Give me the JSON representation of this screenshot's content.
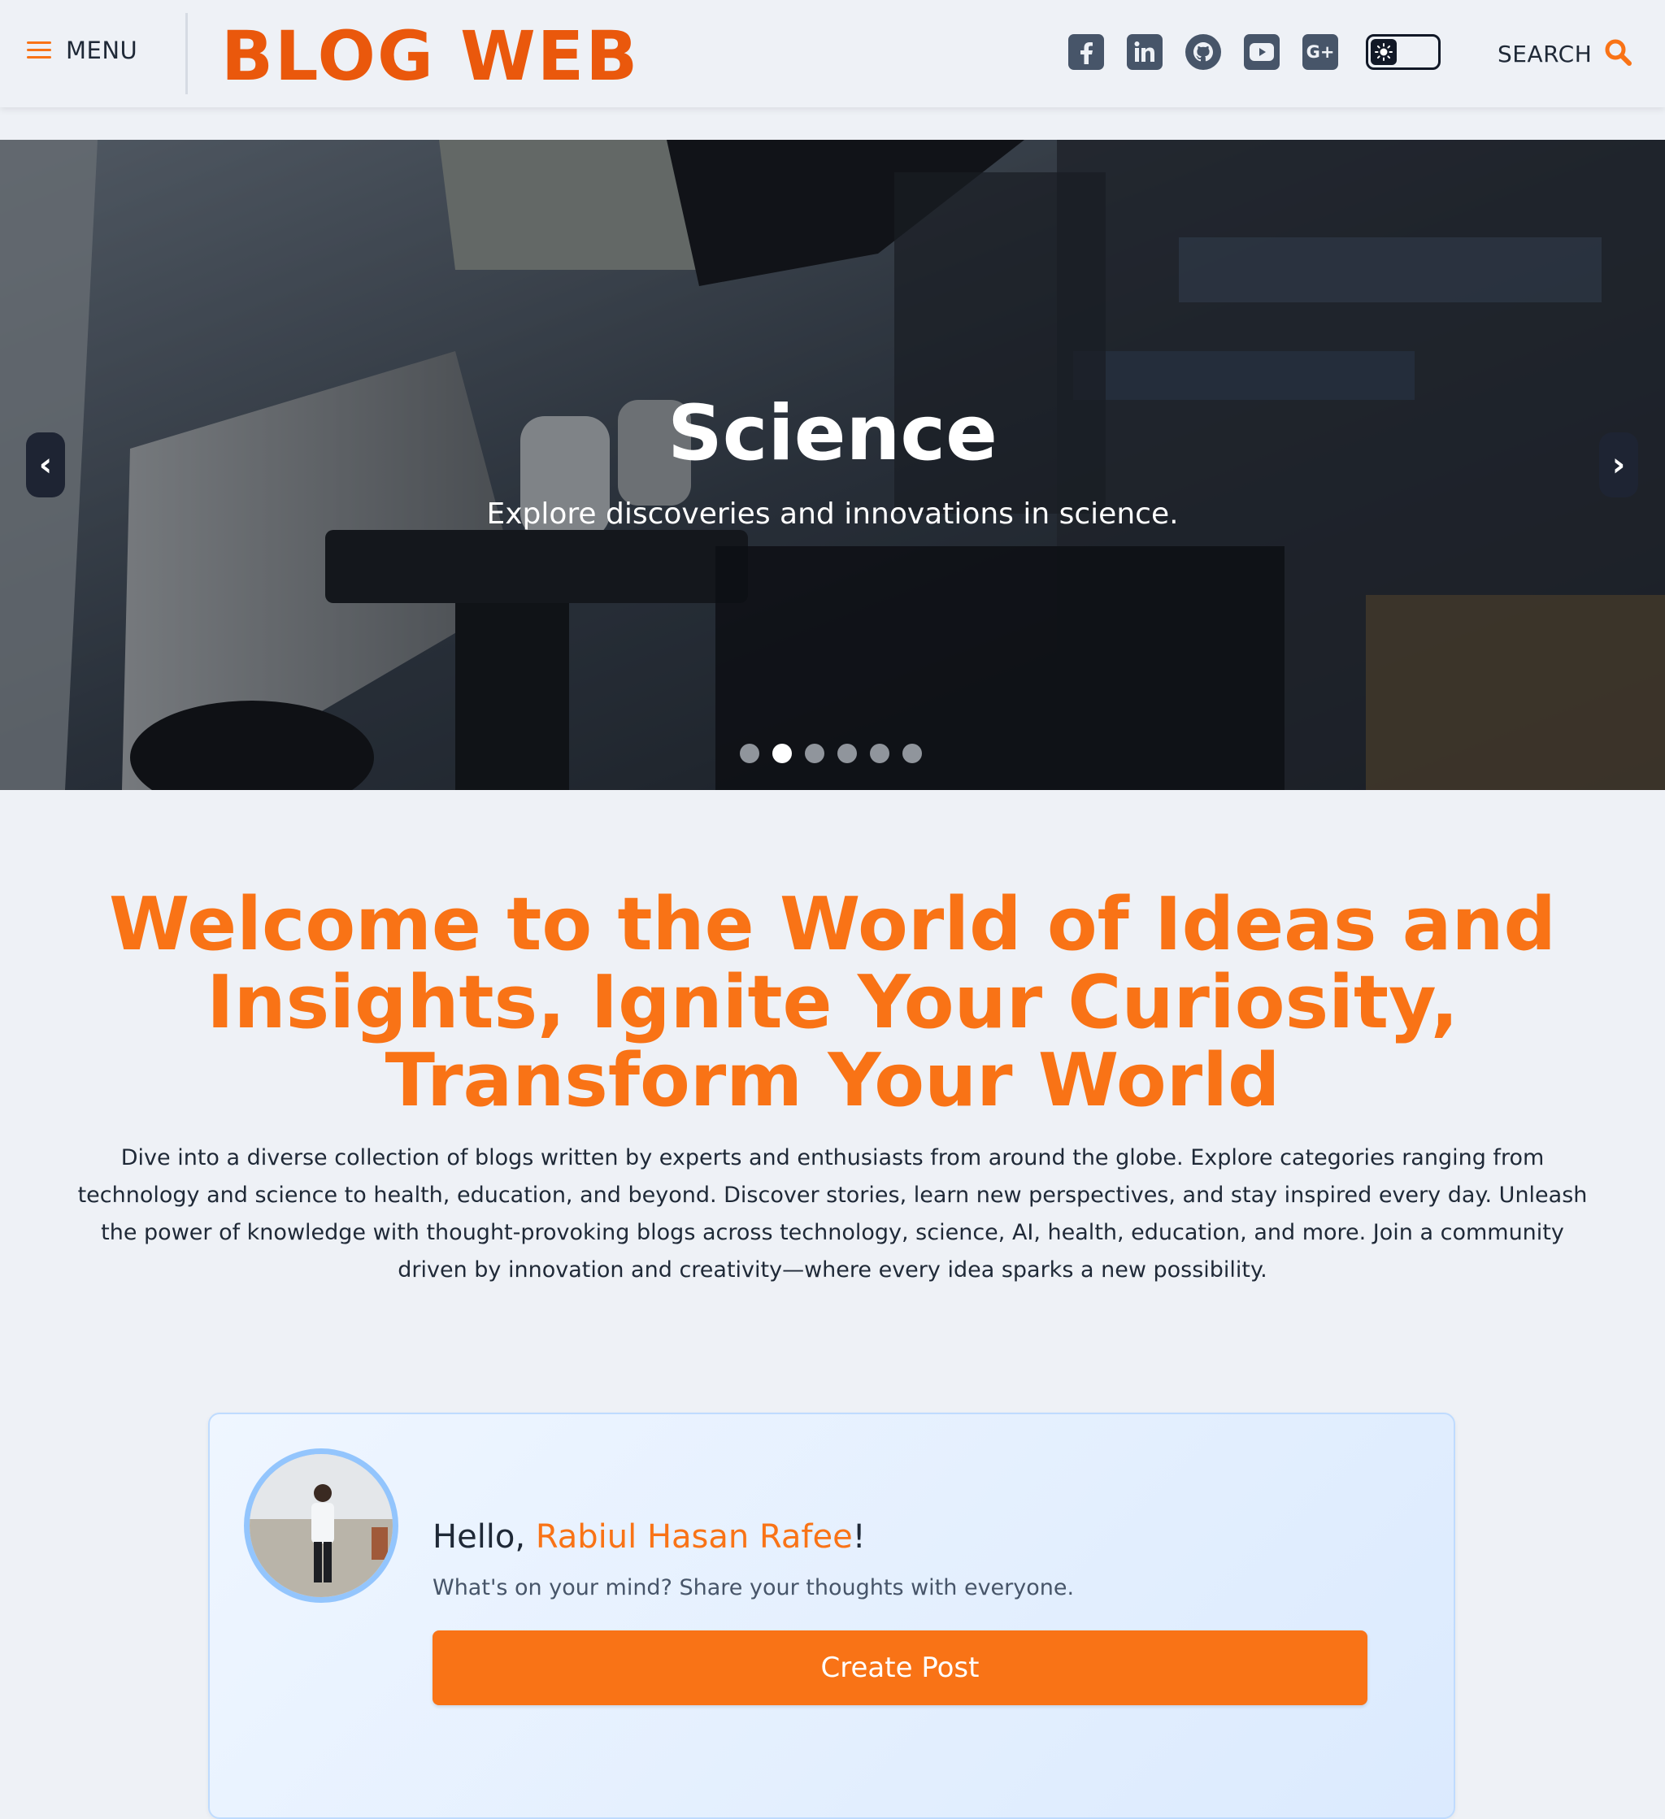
{
  "header": {
    "menu_label": "MENU",
    "logo": "BLOG WEB",
    "socials": [
      "facebook-icon",
      "linkedin-icon",
      "github-icon",
      "youtube-icon",
      "google-plus-icon"
    ],
    "google_plus_text": "G+",
    "linkedin_text": "in",
    "search_label": "SEARCH"
  },
  "hero": {
    "title": "Science",
    "subtitle": "Explore discoveries and innovations in science.",
    "prev": "‹",
    "next": "›",
    "slide_count": 6,
    "active_slide": 2
  },
  "welcome": {
    "title": "Welcome to the World of Ideas and Insights, Ignite Your Curiosity, Transform Your World",
    "text": "Dive into a diverse collection of blogs written by experts and enthusiasts from around the globe. Explore categories ranging from technology and science to health, education, and beyond. Discover stories, learn new perspectives, and stay inspired every day. Unleash the power of knowledge with thought-provoking blogs across technology, science, AI, health, education, and more. Join a community driven by innovation and creativity—where every idea sparks a new possibility."
  },
  "post_card": {
    "greeting_prefix": "Hello, ",
    "user_name": "Rabiul Hasan Rafee",
    "greeting_suffix": "!",
    "prompt": "What's on your mind? Share your thoughts with everyone.",
    "button": "Create Post"
  },
  "colors": {
    "accent": "#f97316",
    "logo": "#ea580c",
    "icon": "#475569",
    "background": "#eef1f6"
  }
}
